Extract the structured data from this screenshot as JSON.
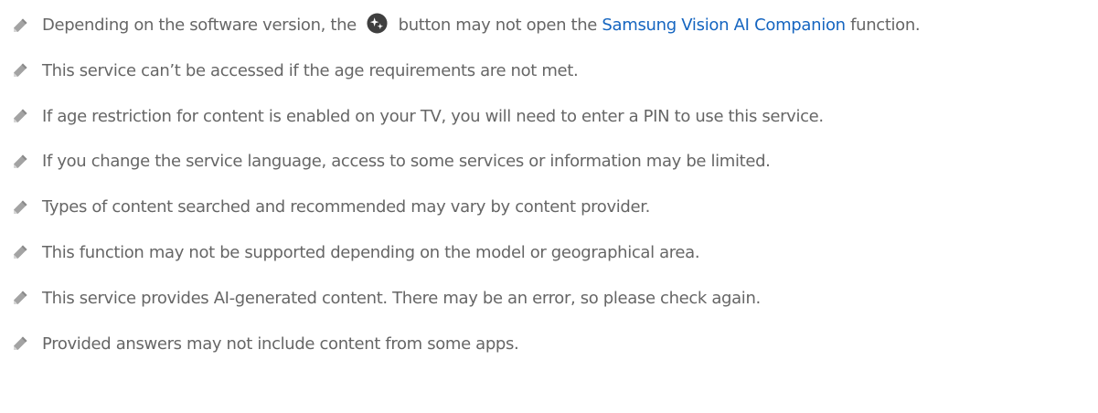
{
  "notes": [
    {
      "before": "Depending on the software version, the",
      "button_icon": "ai-companion-button-icon",
      "middle": "button may not open the",
      "link": "Samsung Vision AI Companion",
      "after": "function."
    },
    {
      "text": "This service can’t be accessed if the age requirements are not met."
    },
    {
      "text": "If age restriction for content is enabled on your TV, you will need to enter a PIN to use this service."
    },
    {
      "text": "If you change the service language, access to some services or information may be limited."
    },
    {
      "text": "Types of content searched and recommended may vary by content provider."
    },
    {
      "text": "This function may not be supported depending on the model or geographical area."
    },
    {
      "text": "This service provides AI-generated content. There may be an error, so please check again."
    },
    {
      "text": "Provided answers may not include content from some apps."
    }
  ],
  "icons": {
    "note": "pencil-icon"
  },
  "colors": {
    "text": "#666666",
    "link": "#1565c0",
    "icon": "#9a9a9a",
    "button_icon": "#3f3f3f"
  }
}
